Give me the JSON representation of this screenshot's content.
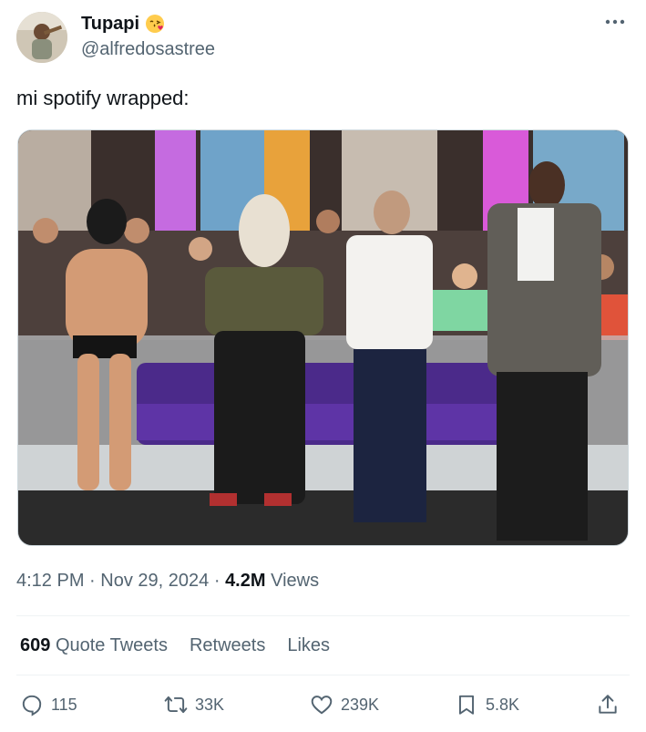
{
  "user": {
    "display_name": "Tupapi",
    "handle": "@alfredosastree"
  },
  "tweet": {
    "text": "mi spotify wrapped:"
  },
  "meta": {
    "time": "4:12 PM",
    "date": "Nov 29, 2024",
    "sep": "·",
    "views_count": "4.2M",
    "views_label": "Views"
  },
  "stats": {
    "quote_count": "609",
    "quote_label": "Quote Tweets",
    "retweets_label": "Retweets",
    "likes_label": "Likes"
  },
  "actions": {
    "replies": "115",
    "retweets": "33K",
    "likes": "239K",
    "bookmarks": "5.8K"
  },
  "icons": {
    "avatar": "avatar-image",
    "emoji": "kissing-face-emoji",
    "more": "more-icon",
    "reply": "reply-icon",
    "retweet": "retweet-icon",
    "like": "heart-icon",
    "bookmark": "bookmark-icon",
    "share": "share-icon"
  },
  "colors": {
    "text": "#0f1419",
    "secondary": "#536471",
    "divider": "#eff3f4"
  }
}
